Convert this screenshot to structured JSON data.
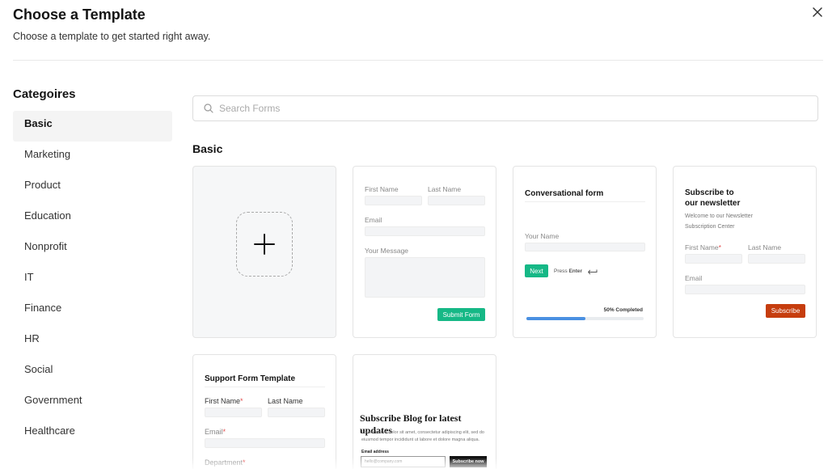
{
  "header": {
    "title": "Choose a Template",
    "subtitle": "Choose a template to get started right away.",
    "close_icon": "close-icon"
  },
  "sidebar": {
    "heading": "Categoires",
    "items": [
      {
        "label": "Basic",
        "active": true
      },
      {
        "label": "Marketing"
      },
      {
        "label": "Product"
      },
      {
        "label": "Education"
      },
      {
        "label": "Nonprofit"
      },
      {
        "label": "IT"
      },
      {
        "label": "Finance"
      },
      {
        "label": "HR"
      },
      {
        "label": "Social"
      },
      {
        "label": "Government"
      },
      {
        "label": "Healthcare"
      }
    ]
  },
  "search": {
    "placeholder": "Search Forms",
    "icon": "search-icon"
  },
  "section_title": "Basic",
  "templates": {
    "blank": {
      "icon": "plus-icon"
    },
    "contact": {
      "first_name": "First Name",
      "last_name": "Last Name",
      "email": "Email",
      "message": "Your Message",
      "submit": "Submit Form"
    },
    "conversational": {
      "title": "Conversational form",
      "name_label": "Your Name",
      "next": "Next",
      "press": "Press",
      "enter": "Enter",
      "progress_text": "50% Completed",
      "progress": 0.5
    },
    "newsletter": {
      "title_line1": "Subscribe to",
      "title_line2": "our newsletter",
      "desc_line1": "Welcome to our Newsletter",
      "desc_line2": "Subscription Center",
      "first_name": "First Name",
      "last_name": "Last Name",
      "email": "Email",
      "subscribe": "Subscribe"
    },
    "support": {
      "title": "Support Form Template",
      "first_name": "First Name",
      "last_name": "Last Name",
      "email": "Email",
      "department": "Department",
      "required_mark": "*"
    },
    "blog": {
      "title": "Subscribe Blog for latest updates",
      "desc_line1": "Lorem ipsum dolor sit amet, consectetur adipiscing elit, sed do",
      "desc_line2": "eiusmod tempor incididunt ut labore et dolore magna aliqua.",
      "email_label": "Email address",
      "email_placeholder": "hello@company.com",
      "button": "Subscribe now"
    }
  },
  "colors": {
    "accent_green": "#16b886",
    "progress_blue": "#4a90e2",
    "subscribe_orange": "#c63d0e",
    "black_button": "#111111",
    "active_bg": "#f4f4f4"
  }
}
